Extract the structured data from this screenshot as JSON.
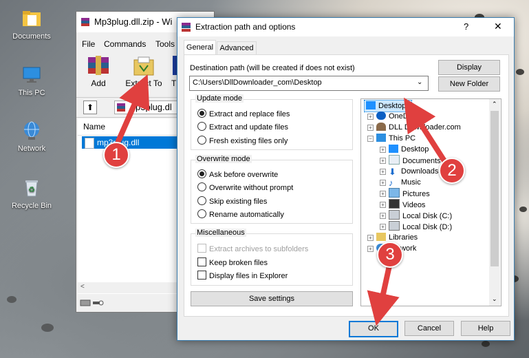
{
  "desktop": {
    "icons": [
      {
        "label": "Documents"
      },
      {
        "label": "This PC"
      },
      {
        "label": "Network"
      },
      {
        "label": "Recycle Bin"
      }
    ]
  },
  "winrar": {
    "title": "Mp3plug.dll.zip - Wi",
    "menu": [
      "File",
      "Commands",
      "Tools"
    ],
    "toolbar": {
      "add": "Add",
      "extract_to": "Extract To",
      "third": "T"
    },
    "path": "p3plug.dl",
    "column_name": "Name",
    "file": "mp3plug.dll"
  },
  "dialog": {
    "title": "Extraction path and options",
    "help": "?",
    "close": "✕",
    "tabs": {
      "general": "General",
      "advanced": "Advanced"
    },
    "dest_label": "Destination path (will be created if does not exist)",
    "dest_value": "C:\\Users\\DllDownloader_com\\Desktop",
    "display_btn": "Display",
    "new_folder_btn": "New Folder",
    "update_mode": {
      "title": "Update mode",
      "options": [
        "Extract and replace files",
        "Extract and update files",
        "Fresh existing files only"
      ]
    },
    "overwrite_mode": {
      "title": "Overwrite mode",
      "options": [
        "Ask before overwrite",
        "Overwrite without prompt",
        "Skip existing files",
        "Rename automatically"
      ]
    },
    "misc": {
      "title": "Miscellaneous",
      "options": [
        "Extract archives to subfolders",
        "Keep broken files",
        "Display files in Explorer"
      ]
    },
    "save_settings": "Save settings",
    "ok": "OK",
    "cancel": "Cancel",
    "help_btn": "Help",
    "tree": {
      "desktop": "Desktop",
      "onedrive": "OneDrive",
      "user": "DLL Downloader.com",
      "thispc": "This PC",
      "children": [
        "Desktop",
        "Documents",
        "Downloads",
        "Music",
        "Pictures",
        "Videos",
        "Local Disk (C:)",
        "Local Disk (D:)"
      ],
      "libraries": "Libraries",
      "network": "Network"
    }
  },
  "markers": [
    "1",
    "2",
    "3"
  ],
  "colors": {
    "accent": "#0078d7",
    "selection": "#cce8ff",
    "marker": "#e0403f"
  }
}
